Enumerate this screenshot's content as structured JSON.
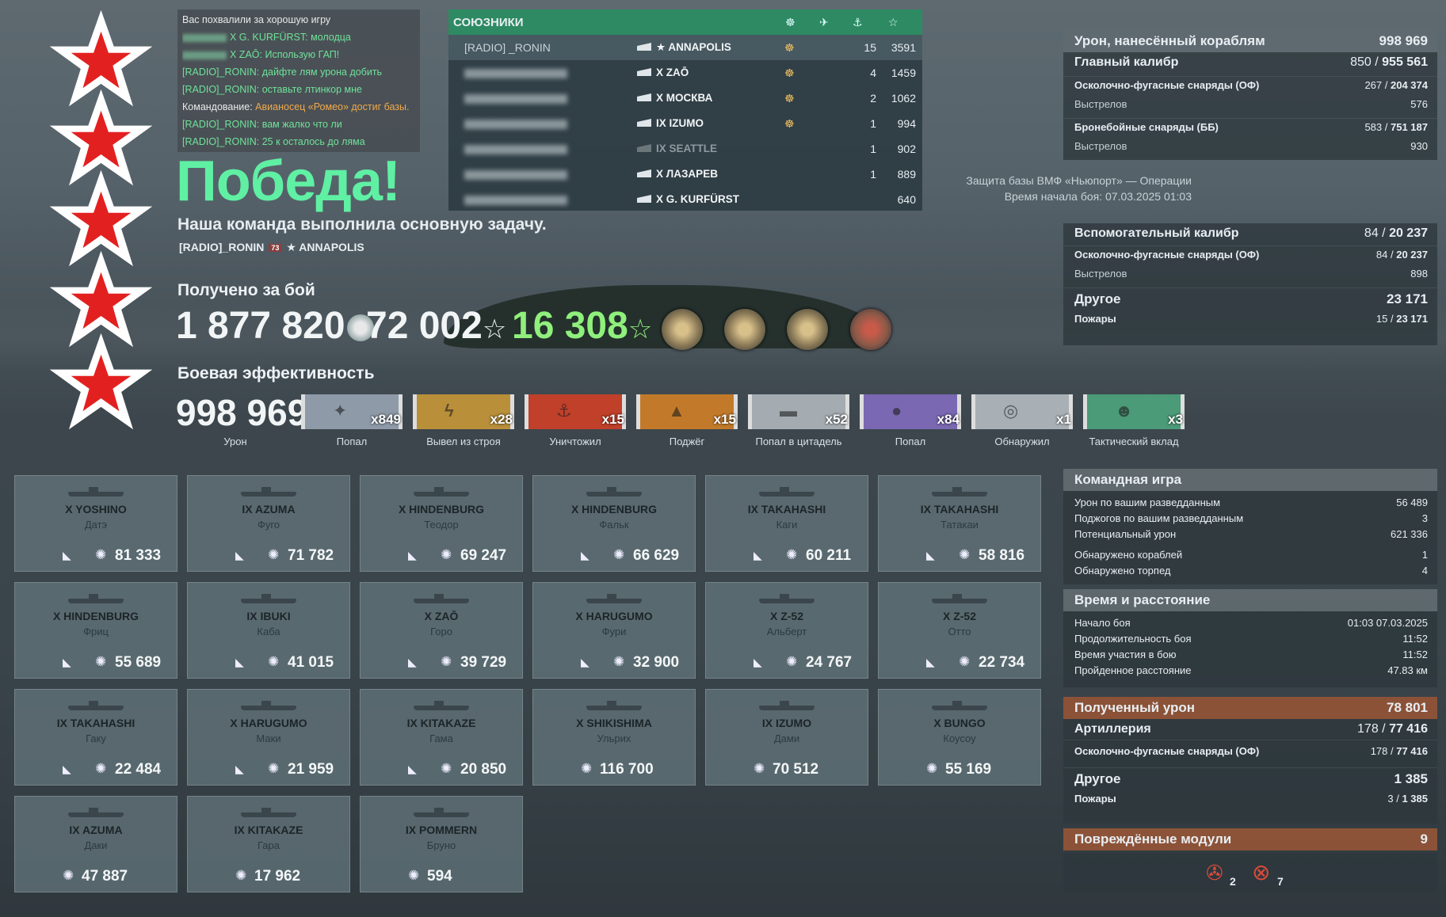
{
  "chat": [
    {
      "name": "",
      "text": "Вас похвалили за хорошую игру",
      "color": "white"
    },
    {
      "name": "X G. KURFÜRST:",
      "text": " молодца",
      "color": "green",
      "blur": true
    },
    {
      "name": "X ZAŌ:",
      "text": " Использую ГАП!",
      "color": "green",
      "blur": true
    },
    {
      "name": "[RADIO]_RONIN:",
      "text": " дайфте лям урона добить",
      "color": "green"
    },
    {
      "name": "[RADIO]_RONIN:",
      "text": " оставьте лтинкор мне",
      "color": "green"
    },
    {
      "name": "Командование:",
      "text": " Авианосец «Ромео» достиг базы.",
      "color": "orange"
    },
    {
      "name": "[RADIO]_RONIN:",
      "text": " вам жалко что ли",
      "color": "green"
    },
    {
      "name": "[RADIO]_RONIN:",
      "text": " 25 к осталось до ляма",
      "color": "green"
    }
  ],
  "allies": {
    "title": "СОЮЗНИКИ",
    "header_icons": [
      "☸",
      "✈",
      "⚓",
      "☆"
    ],
    "rows": [
      {
        "name": "[RADIO] _RONIN",
        "ship": "★ ANNAPOLIS",
        "medal": "☸",
        "kills": "15",
        "xp": "3591",
        "self": true
      },
      {
        "name": "",
        "ship": "X ZAŌ",
        "medal": "☸",
        "kills": "4",
        "xp": "1459",
        "blurred": true
      },
      {
        "name": "",
        "ship": "X МОСКВА",
        "medal": "☸",
        "kills": "2",
        "xp": "1062",
        "blurred": true
      },
      {
        "name": "",
        "ship": "IX IZUMO",
        "medal": "☸",
        "kills": "1",
        "xp": "994",
        "blurred": true
      },
      {
        "name": "",
        "ship": "IX SEATTLE",
        "medal": "",
        "kills": "1",
        "xp": "902",
        "blurred": true,
        "dead": true
      },
      {
        "name": "",
        "ship": "X ЛАЗАРЕВ",
        "medal": "",
        "kills": "1",
        "xp": "889",
        "blurred": true
      },
      {
        "name": "",
        "ship": "X G. KURFÜRST",
        "medal": "",
        "kills": "",
        "xp": "640",
        "blurred": true
      }
    ]
  },
  "result": {
    "title": "Победа!",
    "subtitle": "Наша команда выполнила основную задачу.",
    "player_name": "[RADIO]_RONIN",
    "player_level": "73",
    "player_ship": "★ ANNAPOLIS"
  },
  "earned": {
    "label": "Получено за бой",
    "credits": "1 877 820",
    "xp": "72 002",
    "free_xp": "16 308"
  },
  "efficiency": {
    "label": "Боевая эффективность",
    "damage": "998 969",
    "damage_label": "Урон",
    "ribbons": [
      {
        "count": "x849",
        "label": "Попал",
        "color": "#8e9aa8",
        "glyph": "✦"
      },
      {
        "count": "x28",
        "label": "Вывел из строя",
        "color": "#b98f3a",
        "glyph": "ϟ"
      },
      {
        "count": "x15",
        "label": "Уничтожил",
        "color": "#c0402a",
        "glyph": "⚓"
      },
      {
        "count": "x15",
        "label": "Поджёг",
        "color": "#c27a2a",
        "glyph": "▲"
      },
      {
        "count": "x52",
        "label": "Попал в цитадель",
        "color": "#a4acb2",
        "glyph": "▬"
      },
      {
        "count": "x84",
        "label": "Попал",
        "color": "#7a68b2",
        "glyph": "●"
      },
      {
        "count": "x1",
        "label": "Обнаружил",
        "color": "#a8b0b6",
        "glyph": "◎"
      },
      {
        "count": "x3",
        "label": "Тактический вклад",
        "color": "#4b9a78",
        "glyph": "☻"
      }
    ]
  },
  "damage_panel": {
    "title": "Урон, нанесённый кораблям",
    "total": "998 969",
    "main": {
      "label": "Главный калибр",
      "value_a": "850",
      "value_b": "955 561"
    },
    "he": {
      "label": "Осколочно-фугасные снаряды (ОФ)",
      "value_a": "267",
      "value_b": "204 374"
    },
    "he_shots": {
      "label": "Выстрелов",
      "value": "576"
    },
    "ap": {
      "label": "Бронебойные снаряды (ББ)",
      "value_a": "583",
      "value_b": "751 187"
    },
    "ap_shots": {
      "label": "Выстрелов",
      "value": "930"
    },
    "secondary": {
      "label": "Вспомогательный калибр",
      "value_a": "84",
      "value_b": "20 237"
    },
    "sec_he": {
      "label": "Осколочно-фугасные снаряды (ОФ)",
      "value_a": "84",
      "value_b": "20 237"
    },
    "sec_shots": {
      "label": "Выстрелов",
      "value": "898"
    },
    "other": {
      "label": "Другое",
      "value": "23 171"
    },
    "fires": {
      "label": "Пожары",
      "value_a": "15",
      "value_b": "23 171"
    }
  },
  "battle_info": {
    "line1": "Защита базы ВМФ «Ньюпорт» — Операции",
    "line2": "Время начала боя: 07.03.2025 01:03"
  },
  "team_play": {
    "title": "Командная игра",
    "rows": [
      {
        "l": "Урон по вашим разведданным",
        "r": "56 489"
      },
      {
        "l": "Поджогов по вашим разведданным",
        "r": "3"
      },
      {
        "l": "Потенциальный урон",
        "r": "621 336"
      },
      {
        "l": "Обнаружено кораблей",
        "r": "1"
      },
      {
        "l": "Обнаружено торпед",
        "r": "4"
      }
    ]
  },
  "time_distance": {
    "title": "Время и расстояние",
    "rows": [
      {
        "l": "Начало боя",
        "r": "01:03  07.03.2025"
      },
      {
        "l": "Продолжительность боя",
        "r": "11:52"
      },
      {
        "l": "Время участия в бою",
        "r": "11:52"
      },
      {
        "l": "Пройденное расстояние",
        "r": "47.83 км"
      }
    ]
  },
  "received": {
    "title": "Полученный урон",
    "total": "78 801",
    "art": {
      "label": "Артиллерия",
      "value_a": "178",
      "value_b": "77 416"
    },
    "he": {
      "label": "Осколочно-фугасные снаряды (ОФ)",
      "value_a": "178",
      "value_b": "77 416"
    },
    "other": {
      "label": "Другое",
      "value": "1 385"
    },
    "fires": {
      "label": "Пожары",
      "value_a": "3",
      "value_b": "1 385"
    }
  },
  "modules": {
    "title": "Повреждённые модули",
    "total": "9",
    "counts": [
      "2",
      "7"
    ]
  },
  "ships": [
    {
      "ship": "X YOSHINO",
      "player": "Датэ",
      "damage": "81 333",
      "sunk": true
    },
    {
      "ship": "IX AZUMA",
      "player": "Фуго",
      "damage": "71 782",
      "sunk": true
    },
    {
      "ship": "X HINDENBURG",
      "player": "Теодор",
      "damage": "69 247",
      "sunk": true
    },
    {
      "ship": "X HINDENBURG",
      "player": "Фальк",
      "damage": "66 629",
      "sunk": true
    },
    {
      "ship": "IX TAKAHASHI",
      "player": "Каги",
      "damage": "60 211",
      "sunk": true
    },
    {
      "ship": "IX TAKAHASHI",
      "player": "Татакаи",
      "damage": "58 816",
      "sunk": true
    },
    {
      "ship": "X HINDENBURG",
      "player": "Фриц",
      "damage": "55 689",
      "sunk": true
    },
    {
      "ship": "IX IBUKI",
      "player": "Каба",
      "damage": "41 015",
      "sunk": true
    },
    {
      "ship": "X ZAŌ",
      "player": "Горо",
      "damage": "39 729",
      "sunk": true
    },
    {
      "ship": "X HARUGUMO",
      "player": "Фури",
      "damage": "32 900",
      "sunk": true
    },
    {
      "ship": "X Z-52",
      "player": "Альберт",
      "damage": "24 767",
      "sunk": true
    },
    {
      "ship": "X Z-52",
      "player": "Отто",
      "damage": "22 734",
      "sunk": true
    },
    {
      "ship": "IX TAKAHASHI",
      "player": "Гаку",
      "damage": "22 484",
      "sunk": true
    },
    {
      "ship": "X HARUGUMO",
      "player": "Маки",
      "damage": "21 959",
      "sunk": true
    },
    {
      "ship": "IX KITAKAZE",
      "player": "Гама",
      "damage": "20 850",
      "sunk": true
    },
    {
      "ship": "X SHIKISHIMA",
      "player": "Ульрих",
      "damage": "116 700",
      "sunk": false
    },
    {
      "ship": "IX IZUMO",
      "player": "Дами",
      "damage": "70 512",
      "sunk": false
    },
    {
      "ship": "X BUNGO",
      "player": "Коусоу",
      "damage": "55 169",
      "sunk": false
    },
    {
      "ship": "IX AZUMA",
      "player": "Даки",
      "damage": "47 887",
      "sunk": false
    },
    {
      "ship": "IX KITAKAZE",
      "player": "Гара",
      "damage": "17 962",
      "sunk": false
    },
    {
      "ship": "IX POMMERN",
      "player": "Бруно",
      "damage": "594",
      "sunk": false
    }
  ]
}
